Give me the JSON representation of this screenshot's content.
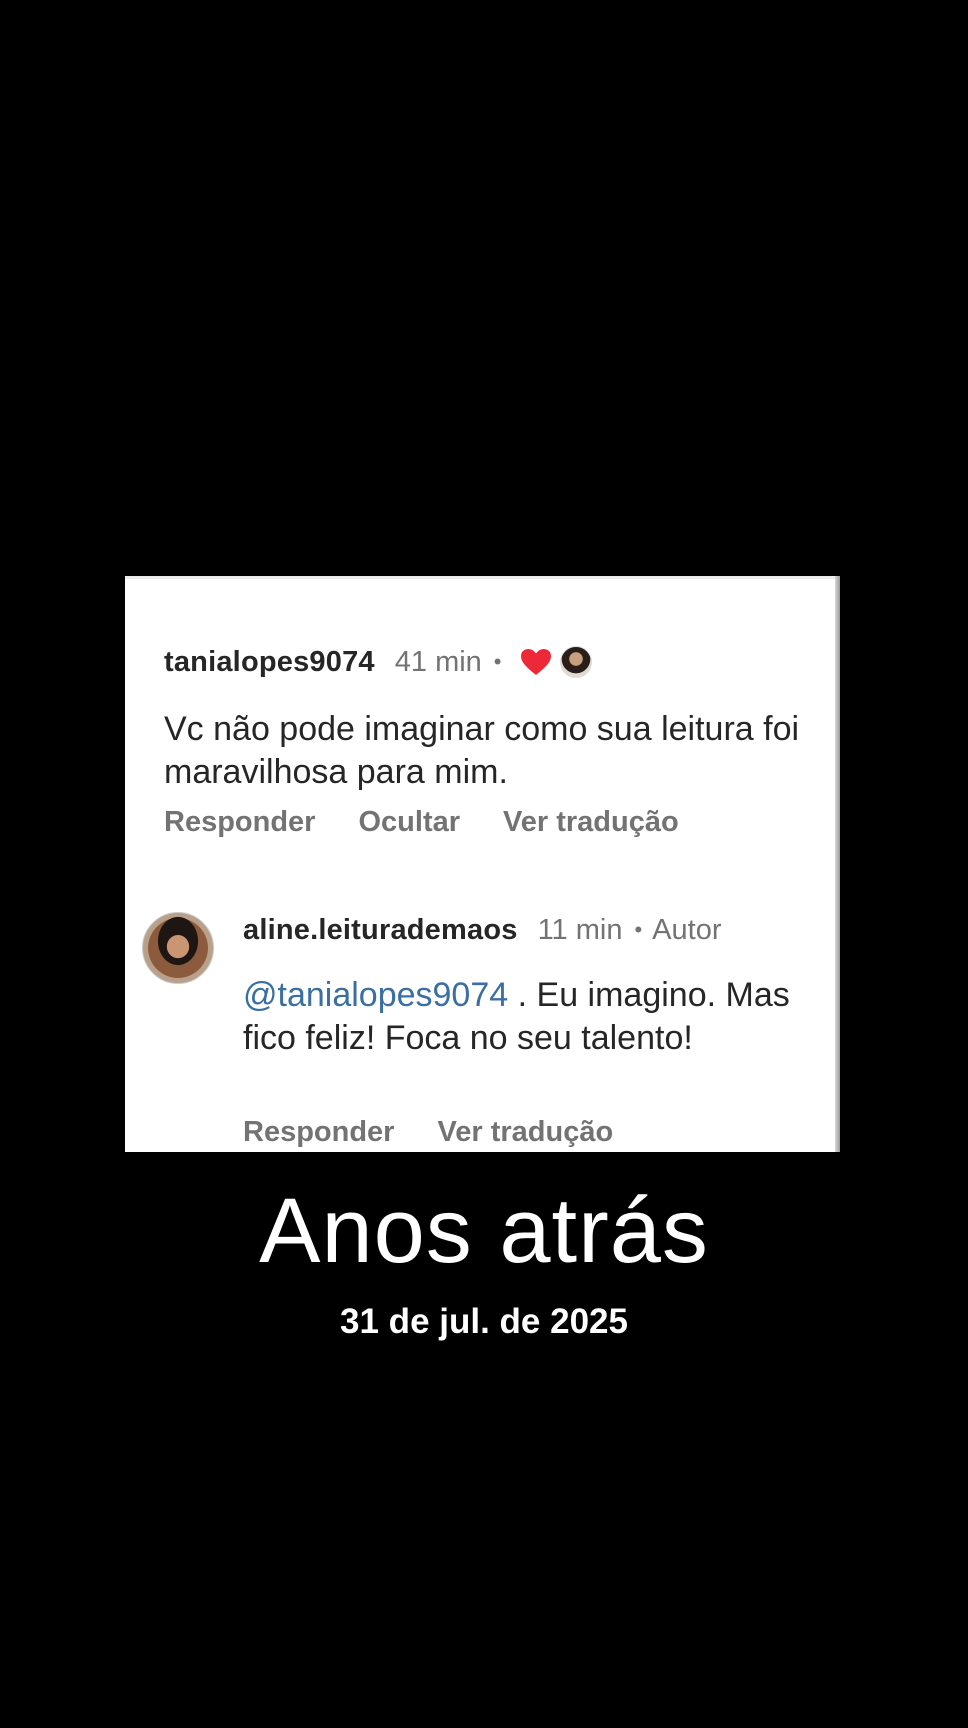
{
  "comment": {
    "username": "tanialopes9074",
    "time": "41 min",
    "separator": "•",
    "liked_icon": "heart-icon",
    "liked_color": "#ed2939",
    "text": "Vc não pode imaginar como sua leitura foi maravilhosa para mim.",
    "actions": [
      "Responder",
      "Ocultar",
      "Ver tradução"
    ]
  },
  "reply": {
    "username": "aline.leiturademaos",
    "time": "11 min",
    "separator": "•",
    "badge": "Autor",
    "mention": "@tanialopes9074",
    "text": " . Eu imagino. Mas fico feliz! Foca no seu talento!",
    "actions": [
      "Responder",
      "Ver tradução"
    ]
  },
  "caption": {
    "title": "Anos atrás",
    "date": "31 de jul. de 2025"
  }
}
